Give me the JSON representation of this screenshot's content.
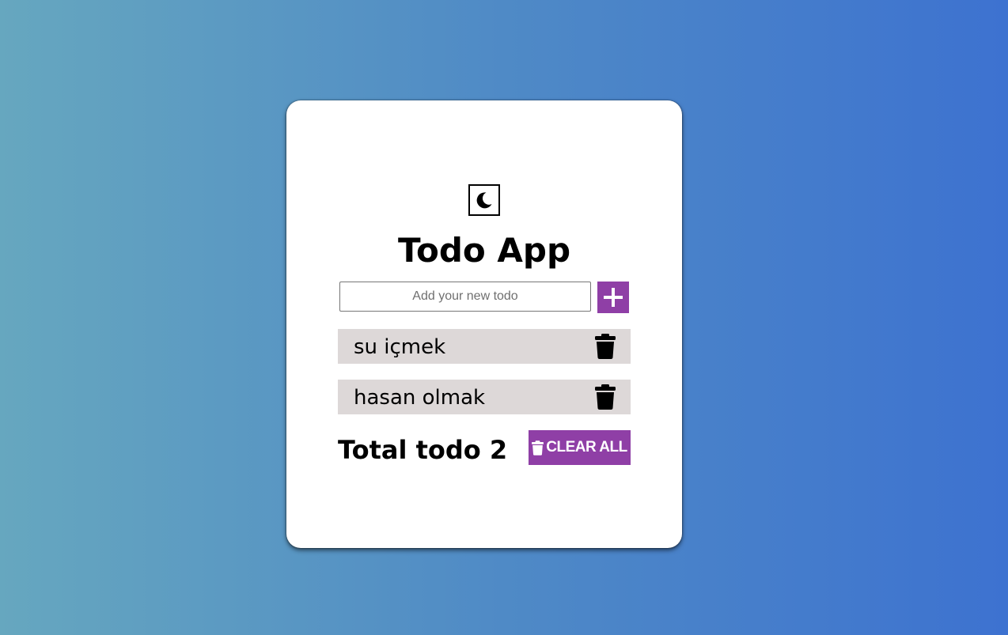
{
  "app": {
    "title": "Todo App"
  },
  "theme_toggle": {
    "icon": "moon-icon"
  },
  "input": {
    "placeholder": "Add your new todo",
    "value": ""
  },
  "add_button": {
    "icon": "plus-icon"
  },
  "todos": [
    {
      "text": "su içmek",
      "delete_icon": "trash-icon"
    },
    {
      "text": "hasan olmak",
      "delete_icon": "trash-icon"
    }
  ],
  "footer": {
    "total_label": "Total todo 2",
    "clear_all_label": "CLEAR ALL",
    "clear_all_icon": "trash-icon"
  },
  "colors": {
    "accent": "#8f3fa6",
    "item_background": "#ddd8d8",
    "card_background": "#ffffff",
    "gradient_start": "#66a7bf",
    "gradient_end": "#3d72d0"
  }
}
